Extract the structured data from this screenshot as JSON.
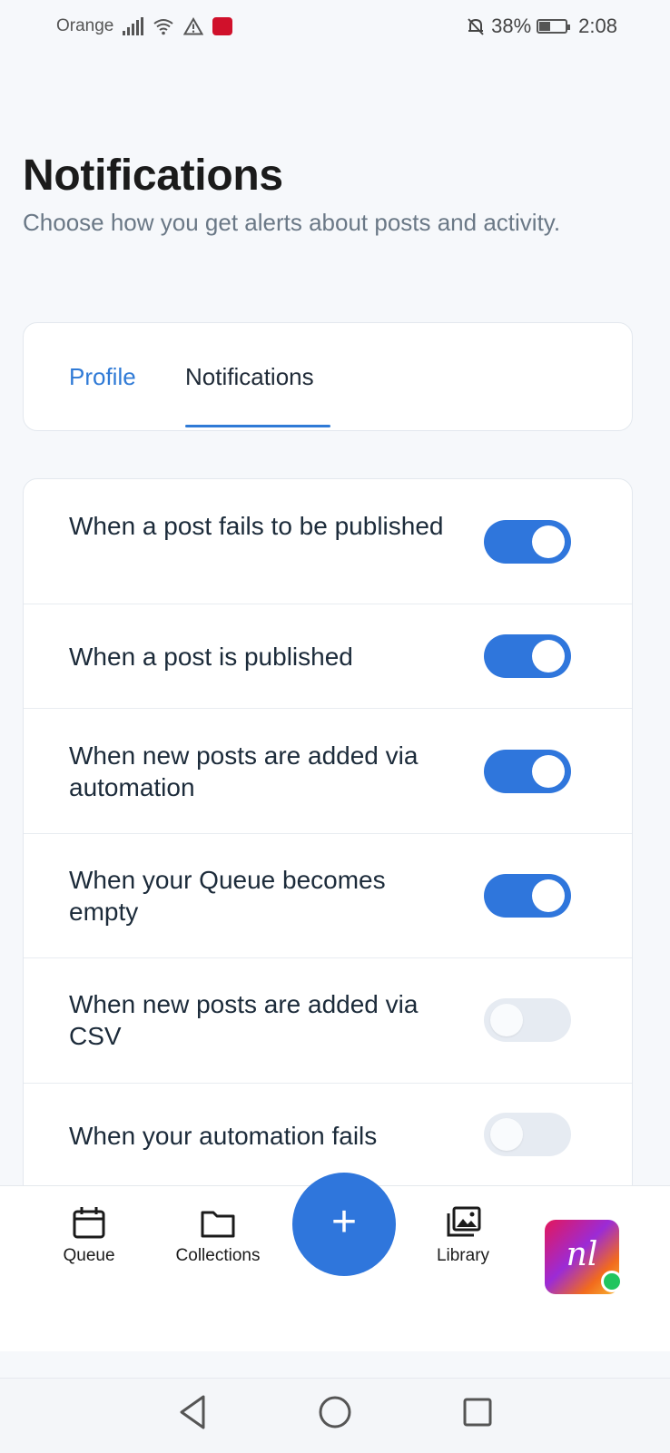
{
  "status_bar": {
    "carrier": "Orange",
    "battery": "38%",
    "time": "2:08"
  },
  "header": {
    "title": "Notifications",
    "subtitle": "Choose how you get alerts about posts and activity."
  },
  "tabs": [
    {
      "label": "Profile",
      "active": false
    },
    {
      "label": "Notifications",
      "active": true
    }
  ],
  "settings": [
    {
      "label": "When a post fails to be published",
      "enabled": true
    },
    {
      "label": "When a post is published",
      "enabled": true
    },
    {
      "label": "When new posts are added via automation",
      "enabled": true
    },
    {
      "label": "When your Queue becomes empty",
      "enabled": true
    },
    {
      "label": "When new posts are added via CSV",
      "enabled": false
    },
    {
      "label": "When your automation fails",
      "enabled": false
    }
  ],
  "bottom_nav": {
    "items": [
      {
        "label": "Queue",
        "icon": "calendar-icon"
      },
      {
        "label": "Collections",
        "icon": "folder-icon"
      },
      {
        "label": "Library",
        "icon": "images-icon"
      }
    ],
    "fab_symbol": "+",
    "avatar_text": "nl"
  },
  "colors": {
    "accent": "#2f76dc",
    "toggle_off": "#e6ebf2",
    "background": "#f6f8fb"
  }
}
